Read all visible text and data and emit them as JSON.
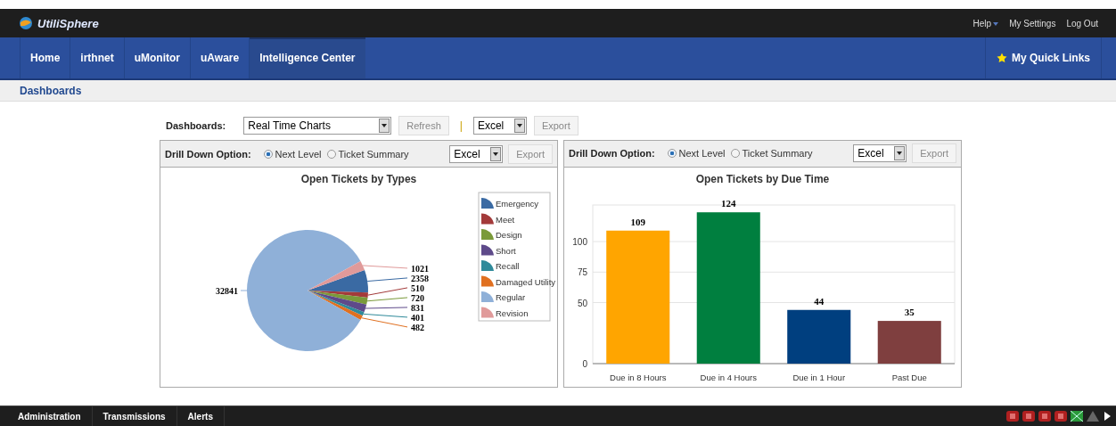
{
  "top_bar": {
    "logo": "UtiliSphere",
    "links": [
      {
        "label": "Help",
        "has_menu": true
      },
      {
        "label": "My Settings",
        "has_menu": false
      },
      {
        "label": "Log Out",
        "has_menu": false
      }
    ]
  },
  "nav": {
    "items": [
      {
        "label": "Home",
        "selected": false
      },
      {
        "label": "irthnet",
        "selected": false
      },
      {
        "label": "uMonitor",
        "selected": false
      },
      {
        "label": "uAware",
        "selected": false
      },
      {
        "label": "Intelligence Center",
        "selected": true
      }
    ],
    "quick_links": "My Quick Links"
  },
  "breadcrumb": "Dashboards",
  "toolbar": {
    "label": "Dashboards:",
    "dashboard": "Real Time Charts",
    "refresh": "Refresh",
    "separator": "|",
    "format": "Excel",
    "export": "Export"
  },
  "panels": [
    {
      "drill_label": "Drill Down Option:",
      "options": [
        {
          "label": "Next Level",
          "selected": true
        },
        {
          "label": "Ticket Summary",
          "selected": false
        }
      ],
      "format": "Excel",
      "export": "Export",
      "chart_data": {
        "type": "pie",
        "title": "Open Tickets by Types",
        "categories": [
          "Emergency",
          "Meet",
          "Design",
          "Short",
          "Recall",
          "Damaged Utility",
          "Regular",
          "Revision"
        ],
        "values": [
          2358,
          510,
          720,
          831,
          401,
          482,
          32841,
          1021
        ],
        "colors": [
          "#3a6aa3",
          "#a33a3a",
          "#7a9a3a",
          "#5e4a8a",
          "#2f8a9a",
          "#e07020",
          "#8fb0d8",
          "#e09a9a"
        ],
        "legend": "right",
        "data_labels": true
      }
    },
    {
      "drill_label": "Drill Down Option:",
      "options": [
        {
          "label": "Next Level",
          "selected": true
        },
        {
          "label": "Ticket Summary",
          "selected": false
        }
      ],
      "format": "Excel",
      "export": "Export",
      "chart_data": {
        "type": "bar",
        "title": "Open Tickets by Due Time",
        "categories": [
          "Due in 8 Hours",
          "Due in 4 Hours",
          "Due in 1 Hour",
          "Past Due"
        ],
        "series": [
          {
            "values": [
              109,
              124,
              44,
              35
            ]
          }
        ],
        "colors": [
          "#ffa500",
          "#007f3f",
          "#003f7f",
          "#7f3f3f"
        ],
        "ylim": [
          0,
          130
        ],
        "yticks": [
          0,
          50,
          75,
          100
        ],
        "grid": true,
        "data_labels": true
      }
    }
  ],
  "footer": {
    "tabs": [
      "Administration",
      "Transmissions",
      "Alerts"
    ]
  }
}
